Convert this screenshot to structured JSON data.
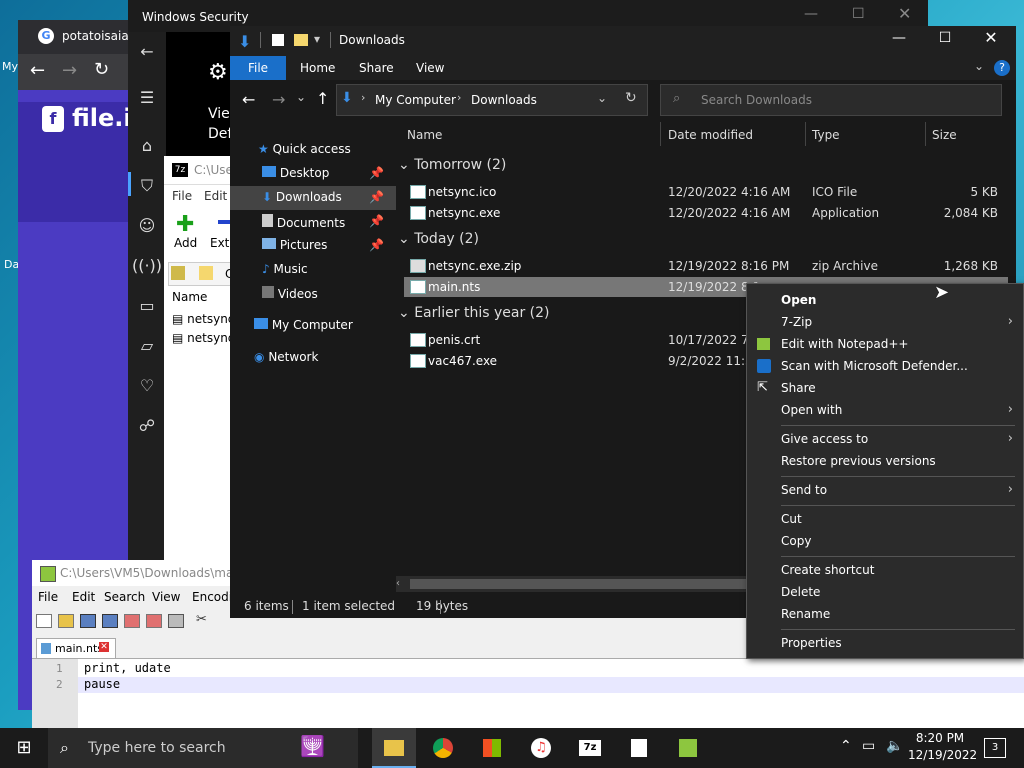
{
  "desktop": {
    "label_my": "My",
    "label_da": "Da"
  },
  "chrome": {
    "tab_title": "potatoisaiah",
    "site_name": "file.io",
    "site_logo_letter": "f"
  },
  "winsec": {
    "title": "Windows Security",
    "view_text": "Vie",
    "def_text": "Def"
  },
  "sevenzip": {
    "path": "C:\\User",
    "menu_file": "File",
    "menu_edit": "Edit",
    "btn_add": "Add",
    "btn_extract": "Extr",
    "col_name": "Name",
    "row1": "netsync",
    "row2": "netsync",
    "addr_letter": "C"
  },
  "notepadpp": {
    "title_path": "C:\\Users\\VM5\\Downloads\\main",
    "menus": [
      "File",
      "Edit",
      "Search",
      "View",
      "Encodi"
    ],
    "tab_label": "main.nts",
    "lines": [
      {
        "num": "1",
        "text": "print, udate"
      },
      {
        "num": "2",
        "text": "pause"
      }
    ]
  },
  "explorer": {
    "title": "Downloads",
    "ribbon_tabs": [
      "File",
      "Home",
      "Share",
      "View"
    ],
    "breadcrumb": [
      "My Computer",
      "Downloads"
    ],
    "search_placeholder": "Search Downloads",
    "nav": {
      "quick_access": "Quick access",
      "desktop": "Desktop",
      "downloads": "Downloads",
      "documents": "Documents",
      "pictures": "Pictures",
      "music": "Music",
      "videos": "Videos",
      "my_computer": "My Computer",
      "network": "Network"
    },
    "columns": {
      "name": "Name",
      "date": "Date modified",
      "type": "Type",
      "size": "Size"
    },
    "groups": {
      "tomorrow": "Tomorrow (2)",
      "today": "Today (2)",
      "earlier": "Earlier this year (2)"
    },
    "files": {
      "f1": {
        "name": "netsync.ico",
        "date": "12/20/2022 4:16 AM",
        "type": "ICO File",
        "size": "5 KB"
      },
      "f2": {
        "name": "netsync.exe",
        "date": "12/20/2022 4:16 AM",
        "type": "Application",
        "size": "2,084 KB"
      },
      "f3": {
        "name": "netsync.exe.zip",
        "date": "12/19/2022 8:16 PM",
        "type": "zip Archive",
        "size": "1,268 KB"
      },
      "f4": {
        "name": "main.nts",
        "date": "12/19/2022 8:1"
      },
      "f5": {
        "name": "penis.crt",
        "date": "10/17/2022 7:5"
      },
      "f6": {
        "name": "vac467.exe",
        "date": "9/2/2022 11:37"
      }
    },
    "status": {
      "items": "6 items",
      "selected": "1 item selected",
      "bytes": "19 bytes"
    }
  },
  "context_menu": {
    "open": "Open",
    "sevenzip": "7-Zip",
    "edit_npp": "Edit with Notepad++",
    "scan": "Scan with Microsoft Defender...",
    "share": "Share",
    "open_with": "Open with",
    "give_access": "Give access to",
    "restore": "Restore previous versions",
    "send_to": "Send to",
    "cut": "Cut",
    "copy": "Copy",
    "create_shortcut": "Create shortcut",
    "delete": "Delete",
    "rename": "Rename",
    "properties": "Properties"
  },
  "taskbar": {
    "search_placeholder": "Type here to search",
    "time": "8:20 PM",
    "date": "12/19/2022",
    "notification_count": "3"
  }
}
